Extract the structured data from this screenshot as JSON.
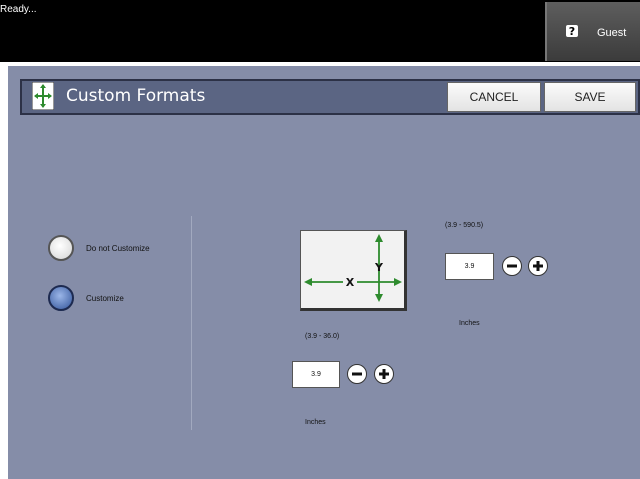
{
  "status": {
    "text": "Ready..."
  },
  "user": {
    "label": "Guest"
  },
  "header": {
    "title": "Custom Formats",
    "cancel_label": "CANCEL",
    "save_label": "SAVE"
  },
  "options": [
    {
      "label": "Do not Customize",
      "selected": false
    },
    {
      "label": "Customize",
      "selected": true
    }
  ],
  "diagram": {
    "x_label": "X",
    "y_label": "Y"
  },
  "y_dimension": {
    "range": "(3.9 - 590.5)",
    "value": "3.9",
    "unit": "Inches"
  },
  "x_dimension": {
    "range": "(3.9 - 36.0)",
    "value": "3.9",
    "unit": "Inches"
  },
  "colors": {
    "arrow": "#2e8b2e",
    "panel": "#858da8",
    "titlebar": "#5b6583"
  }
}
